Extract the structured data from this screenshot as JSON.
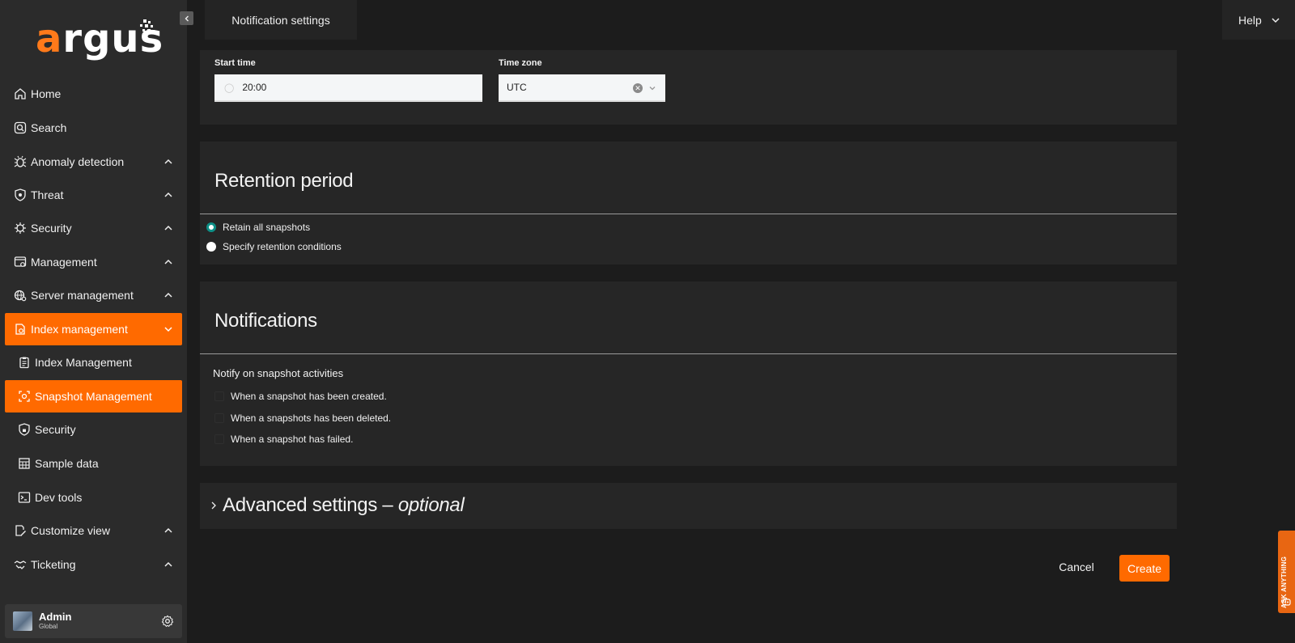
{
  "app": {
    "logo_text_accent": "a",
    "logo_text_rest": "rgus",
    "accent_color": "#ff6a00"
  },
  "header": {
    "tab_title": "Notification settings",
    "help_label": "Help"
  },
  "sidebar": {
    "items": [
      {
        "label": "Home",
        "icon": "home-icon"
      },
      {
        "label": "Search",
        "icon": "search-icon"
      },
      {
        "label": "Anomaly detection",
        "icon": "bug-icon"
      },
      {
        "label": "Threat",
        "icon": "shield-icon"
      },
      {
        "label": "Security",
        "icon": "virus-icon"
      },
      {
        "label": "Management",
        "icon": "browser-gear-icon"
      },
      {
        "label": "Server management",
        "icon": "globe-gear-icon"
      },
      {
        "label": "Index management",
        "icon": "index-icon"
      },
      {
        "label": "Index Management",
        "icon": "clipboard-icon"
      },
      {
        "label": "Snapshot Management",
        "icon": "snapshot-icon"
      },
      {
        "label": "Security",
        "icon": "shield-lock-icon"
      },
      {
        "label": "Sample data",
        "icon": "grid-icon"
      },
      {
        "label": "Dev tools",
        "icon": "terminal-icon"
      },
      {
        "label": "Customize view",
        "icon": "edit-doc-icon"
      },
      {
        "label": "Ticketing",
        "icon": "handshake-icon"
      }
    ],
    "user": {
      "name": "Admin",
      "scope": "Global"
    }
  },
  "schedule": {
    "start_time_label": "Start time",
    "start_time_value": "20:00",
    "timezone_label": "Time zone",
    "timezone_value": "UTC"
  },
  "retention": {
    "title": "Retention period",
    "options": [
      {
        "label": "Retain all snapshots",
        "selected": true
      },
      {
        "label": "Specify retention conditions",
        "selected": false
      }
    ]
  },
  "notifications": {
    "title": "Notifications",
    "subtitle": "Notify on snapshot activities",
    "options": [
      "When a snapshot has been created.",
      "When a snapshots has been deleted.",
      "When a snapshot has failed."
    ]
  },
  "advanced": {
    "title": "Advanced settings –",
    "optional": "optional"
  },
  "actions": {
    "cancel": "Cancel",
    "create": "Create"
  },
  "assistant": {
    "label": "ASK ANYTHING"
  }
}
